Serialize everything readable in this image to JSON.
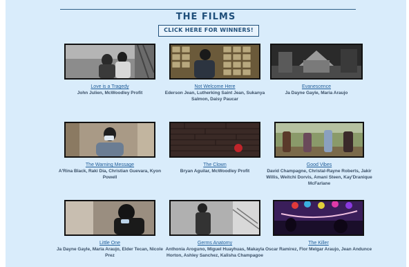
{
  "header": {
    "title": "THE FILMS",
    "winners_button": "CLICK HERE FOR WINNERS!"
  },
  "films": [
    {
      "title": "Love is a Tragedy",
      "credits": "John Julien, McWoodley Profit"
    },
    {
      "title": "Not Welcome Here",
      "credits": "Ederson Jean, Lutherking Saint Jean, Sukanya Salmon, Daisy Paucar"
    },
    {
      "title": "Evanescence",
      "credits": "Ja Dayne Gayle, Maria Araujo"
    },
    {
      "title": "The Warning Message",
      "credits": "A'Rina Black, Raki Dia, Christian Guevara, Kyon Powell"
    },
    {
      "title": "The Clown",
      "credits": "Bryan Aguilar, McWoodley Profit"
    },
    {
      "title": "Good Vibes",
      "credits": "David Champagne, Christal-Rayne Roberts, Jakir Willis, Weitchi Dorvis, Amani Steen, Kay'Dranique McFarlane"
    },
    {
      "title": "Little One",
      "credits": "Ja Dayne Gayle, Maria Araujo, Elder Tecan, Nicole Prez"
    },
    {
      "title": "Germs Anatomy",
      "credits": "Anthonia Aroguno, Miguel Huayhuas, Makayla Horton, Ashley Sanchez, Kalisha Champagoe"
    },
    {
      "title": "The Killer",
      "credits": "Oscar Ramirez, Flor Melgar Araujo, Jean Anduncе"
    }
  ]
}
